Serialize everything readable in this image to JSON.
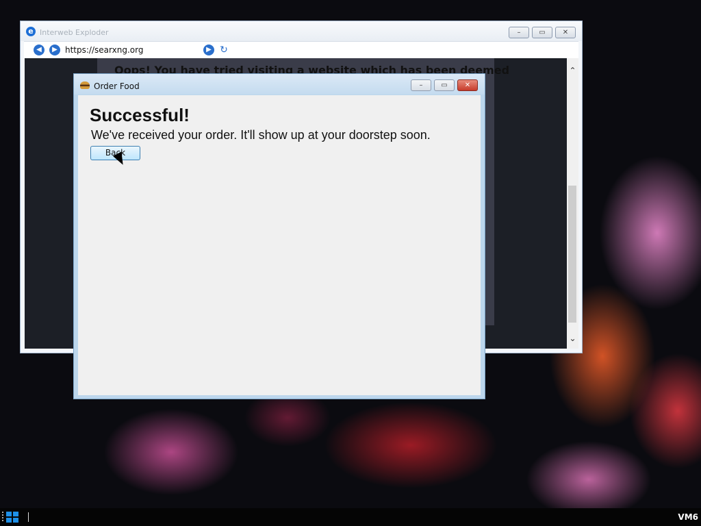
{
  "browser": {
    "title": "Interweb Exploder",
    "url": "https://searxng.org",
    "page_message": "Oops! You have tried visiting a website which has been deemed"
  },
  "dialog": {
    "title": "Order Food",
    "heading": "Successful!",
    "message": "We've received your order. It'll show up at your doorstep soon.",
    "back_label": "Back"
  },
  "taskbar": {
    "label": "VM6"
  },
  "icons": {
    "minimize": "–",
    "maximize": "▭",
    "close": "✕",
    "back_arrow": "◀",
    "forward_arrow": "▶",
    "go_arrow": "▶",
    "refresh": "↻",
    "scroll_up": "⌃",
    "scroll_down": "⌄",
    "ie": "e"
  }
}
